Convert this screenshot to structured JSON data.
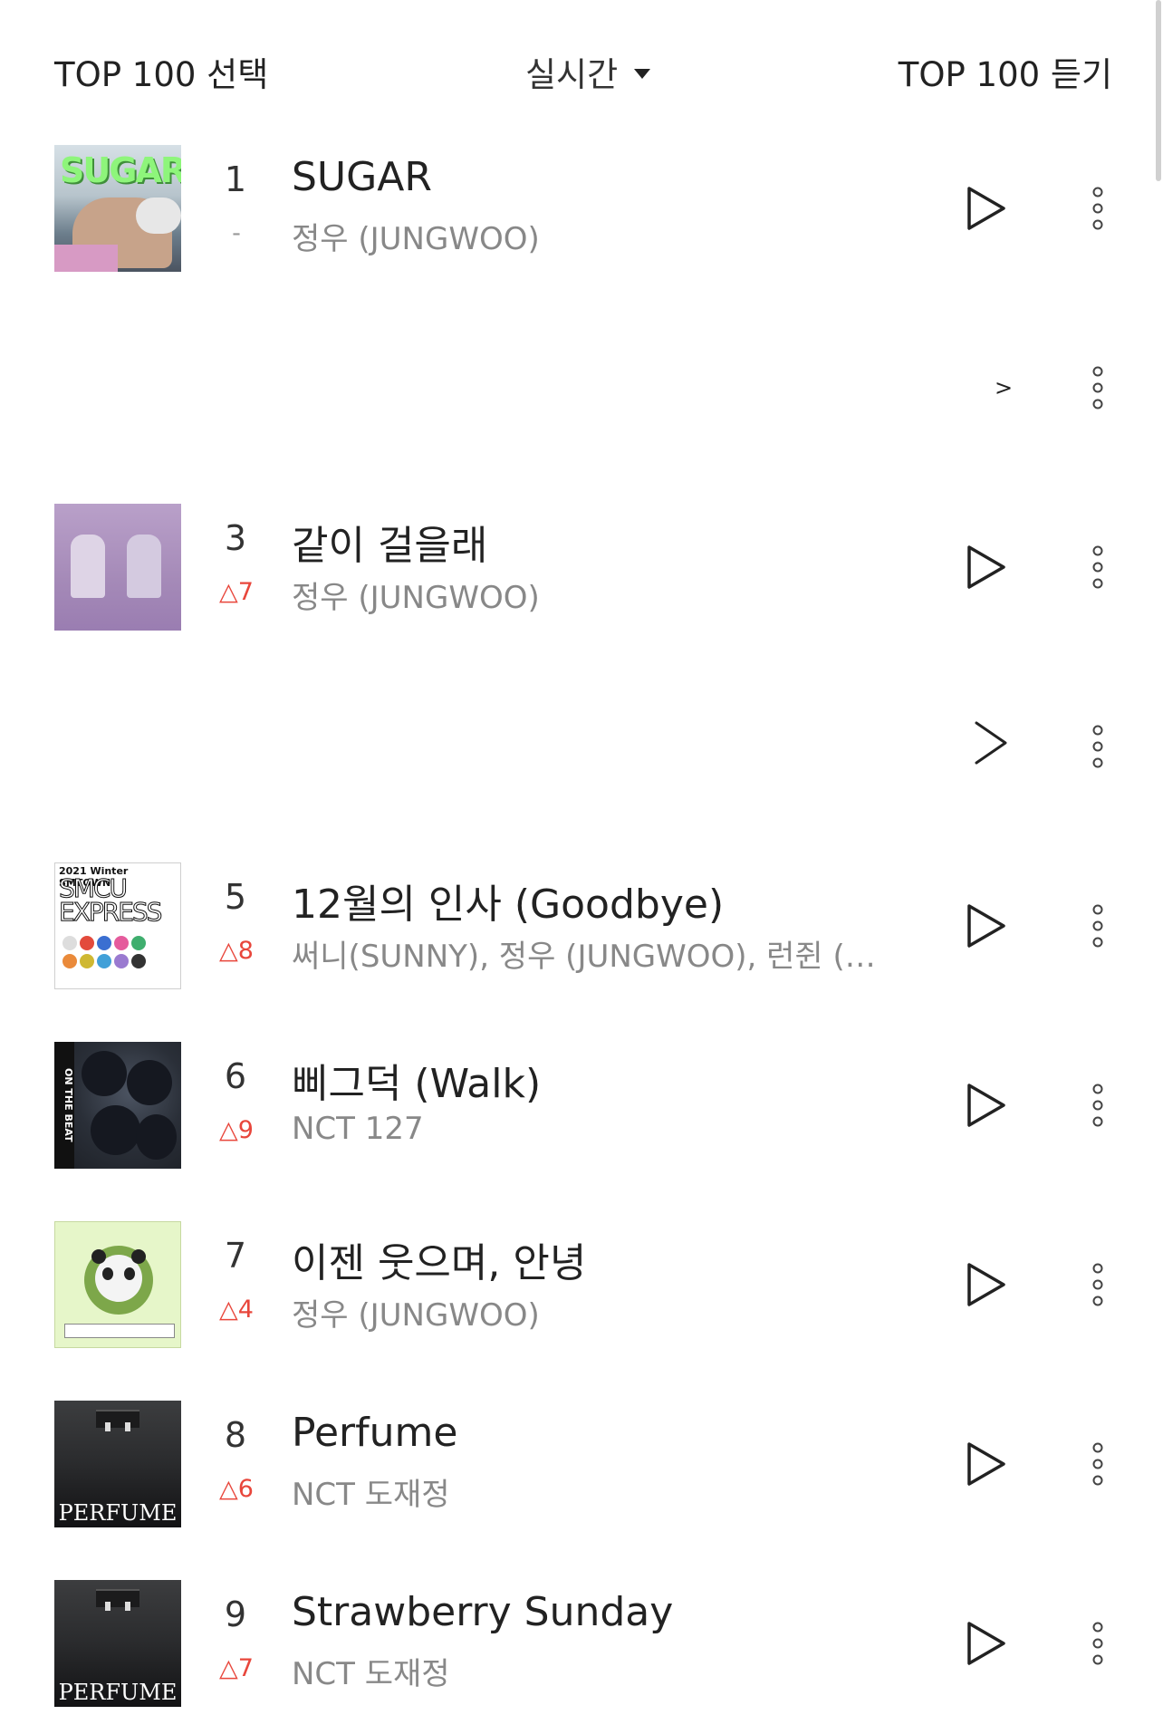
{
  "header": {
    "select_label": "TOP 100 선택",
    "mode_label": "실시간",
    "listen_label": "TOP 100 듣기"
  },
  "tracks": [
    {
      "rank": "1",
      "change": "-",
      "change_dir": "same",
      "title": "SUGAR",
      "artist": "정우 (JUNGWOO)",
      "art": "sugar-cover",
      "art_text": "SUGAR"
    },
    {
      "rank": "",
      "change": "",
      "change_dir": "",
      "title": "",
      "artist": "",
      "play_glyph": ">"
    },
    {
      "rank": "3",
      "change": "△7",
      "change_dir": "up",
      "title": "같이 걸을래",
      "artist": "정우 (JUNGWOO)",
      "art": "walk-cover"
    },
    {
      "rank": "",
      "change": "",
      "change_dir": "",
      "title": "",
      "artist": ""
    },
    {
      "rank": "5",
      "change": "△8",
      "change_dir": "up",
      "title": "12월의 인사 (Goodbye)",
      "artist": "써니(SUNNY), 정우 (JUNGWOO), 런쥔 (…",
      "art": "smtown-cover",
      "art_top": "2021 Winter SMTOWN",
      "art_big1": "SMCU",
      "art_big2": "EXPRESS"
    },
    {
      "rank": "6",
      "change": "△9",
      "change_dir": "up",
      "title": "삐그덕 (Walk)",
      "artist": "NCT 127",
      "art": "onthebeat-cover",
      "art_side": "ON THE BEAT"
    },
    {
      "rank": "7",
      "change": "△4",
      "change_dir": "up",
      "title": "이젠 웃으며, 안녕",
      "artist": "정우 (JUNGWOO)",
      "art": "panda-cover"
    },
    {
      "rank": "8",
      "change": "△6",
      "change_dir": "up",
      "title": "Perfume",
      "artist": "NCT 도재정",
      "art": "perfume-cover",
      "art_name": "PERFUME"
    },
    {
      "rank": "9",
      "change": "△7",
      "change_dir": "up",
      "title": "Strawberry Sunday",
      "artist": "NCT 도재정",
      "art": "perfume-cover",
      "art_name": "PERFUME"
    }
  ],
  "colors": {
    "rank_up": "#e8463b",
    "artist_gray": "#888888"
  },
  "icons": {
    "play": "play-icon",
    "more": "more-vertical-icon",
    "dropdown": "caret-down-icon"
  }
}
